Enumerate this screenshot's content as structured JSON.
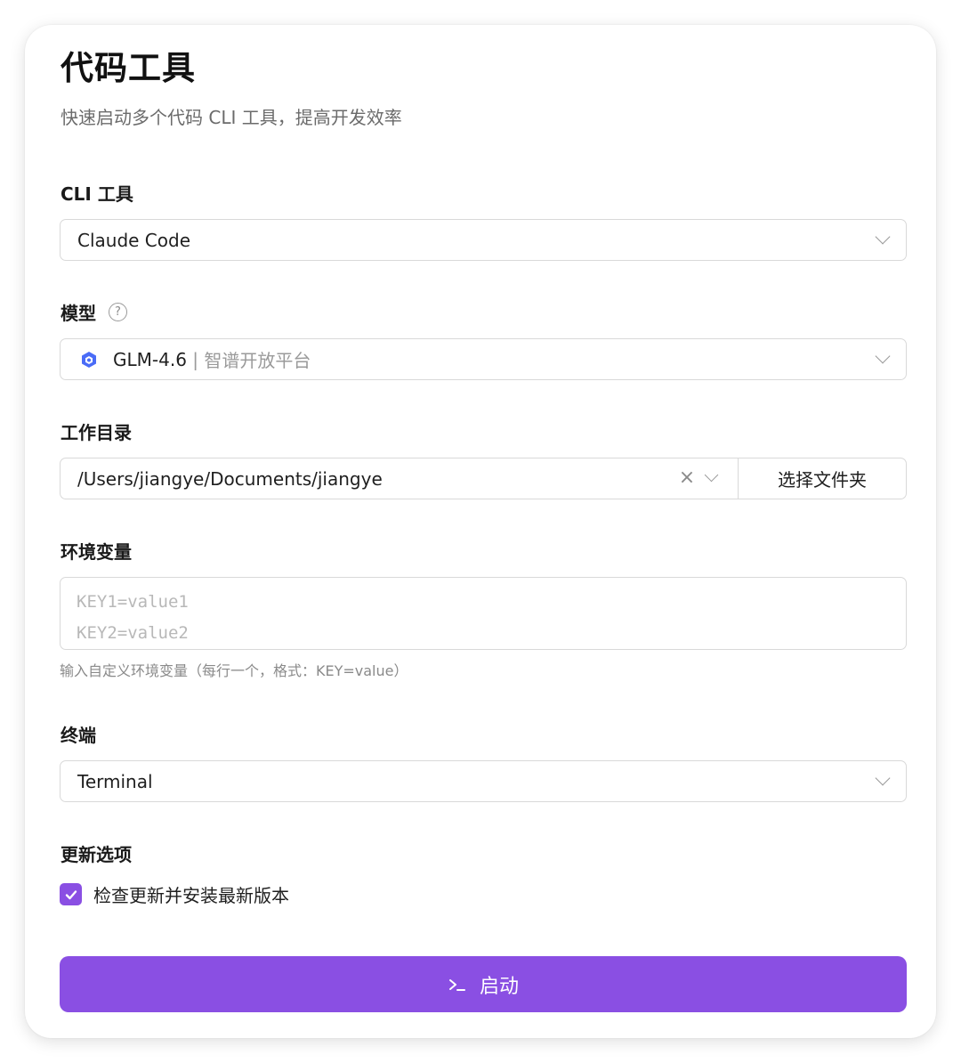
{
  "header": {
    "title": "代码工具",
    "subtitle": "快速启动多个代码 CLI 工具，提高开发效率"
  },
  "cli_tool": {
    "label": "CLI 工具",
    "value": "Claude Code"
  },
  "model": {
    "label": "模型",
    "help": "?",
    "name": "GLM-4.6",
    "separator": " | ",
    "provider": "智谱开放平台",
    "icon": "hexagon-logo-icon"
  },
  "work_dir": {
    "label": "工作目录",
    "value": "/Users/jiangye/Documents/jiangye",
    "choose_button": "选择文件夹"
  },
  "env": {
    "label": "环境变量",
    "placeholder": "KEY1=value1\nKEY2=value2",
    "hint": "输入自定义环境变量（每行一个，格式：KEY=value）"
  },
  "terminal": {
    "label": "终端",
    "value": "Terminal"
  },
  "update": {
    "label": "更新选项",
    "checkbox_label": "检查更新并安装最新版本",
    "checked": true
  },
  "launch": {
    "label": "启动",
    "icon": "terminal-prompt-icon"
  },
  "colors": {
    "accent": "#8a4fe3",
    "model_icon": "#4a6cf7"
  }
}
